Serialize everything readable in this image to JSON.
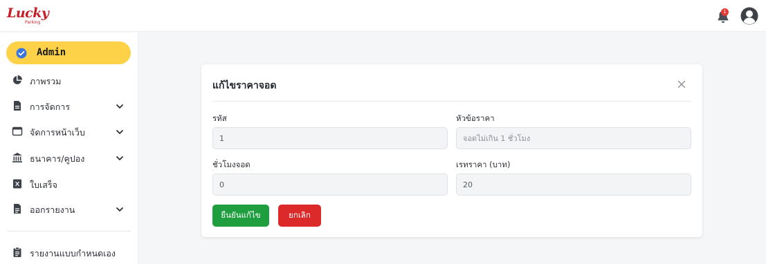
{
  "brand": {
    "name": "Lucky",
    "tagline": "Parking",
    "color": "#c41e26"
  },
  "header": {
    "notification_count": "1",
    "notification_color": "#e53935"
  },
  "sidebar": {
    "role": {
      "label": "Admin",
      "icon": "check-badge-icon",
      "bg": "#fdd249"
    },
    "items": [
      {
        "label": "ภาพรวม",
        "icon": "pie-chart-icon",
        "has_submenu": false
      },
      {
        "label": "การจัดการ",
        "icon": "document-icon",
        "has_submenu": true
      },
      {
        "label": "จัดการหน้าเว็บ",
        "icon": "browser-window-icon",
        "has_submenu": true
      },
      {
        "label": "ธนาคาร/คูปอง",
        "icon": "bank-icon",
        "has_submenu": true
      },
      {
        "label": "ใบเสร็จ",
        "icon": "receipt-icon",
        "has_submenu": false
      },
      {
        "label": "ออกรายงาน",
        "icon": "report-file-icon",
        "has_submenu": true
      },
      {
        "label": "รายงานแบบกำหนดเอง",
        "icon": "clipboard-icon",
        "has_submenu": false
      }
    ]
  },
  "modal": {
    "title": "แก้ไขราคาจอด",
    "fields": {
      "code": {
        "label": "รหัส",
        "value": "1"
      },
      "price_title": {
        "label": "หัวข้อราคา",
        "placeholder": "จอดไม่เกิน 1 ชั่วโมง"
      },
      "parking_hours": {
        "label": "ชั่วโมงจอด",
        "value": "0"
      },
      "start_price": {
        "label": "เรทราคา (บาท)",
        "value": "20"
      }
    },
    "buttons": {
      "confirm": {
        "label": "ยืนยันแก้ไข",
        "color": "#1e9e3e"
      },
      "cancel": {
        "label": "ยกเลิก",
        "color": "#dc2a2a"
      }
    }
  }
}
